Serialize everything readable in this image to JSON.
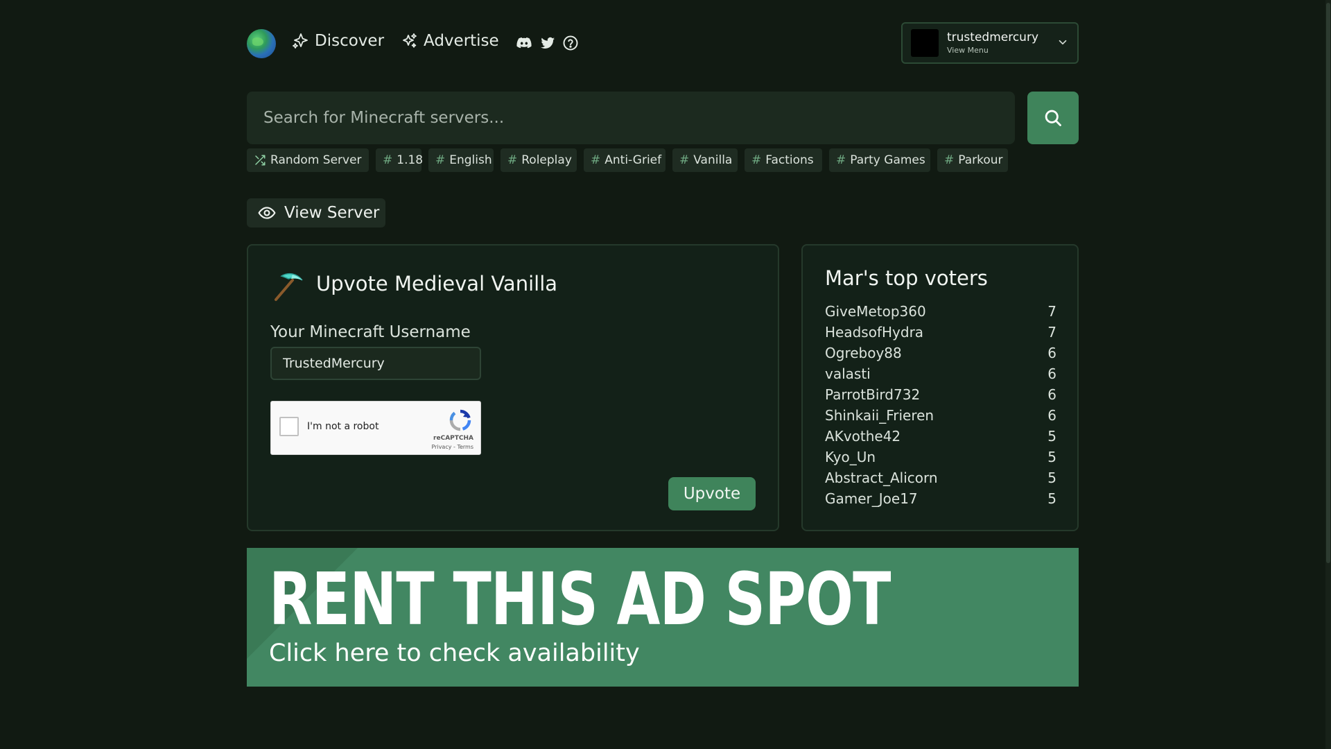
{
  "nav": {
    "discover": "Discover",
    "advertise": "Advertise",
    "icons": [
      "sparkle-icon",
      "sparkles-icon",
      "discord-icon",
      "twitter-icon",
      "help-circle-icon"
    ]
  },
  "user": {
    "name": "trustedmercury",
    "sub": "View Menu"
  },
  "search": {
    "placeholder": "Search for Minecraft servers..."
  },
  "tags": {
    "random": "Random Server",
    "items": [
      "1.18",
      "English",
      "Roleplay",
      "Anti-Grief",
      "Vanilla",
      "Factions",
      "Party Games",
      "Parkour"
    ],
    "hash": "#"
  },
  "view_server": "View Server",
  "vote": {
    "title": "Upvote Medieval Vanilla",
    "field_label": "Your Minecraft Username",
    "username": "TrustedMercury",
    "captcha_text": "I'm not a robot",
    "captcha_brand": "reCAPTCHA",
    "captcha_links": "Privacy - Terms",
    "button": "Upvote"
  },
  "top_voters": {
    "title": "Mar's top voters",
    "list": [
      {
        "name": "GiveMetop360",
        "votes": "7"
      },
      {
        "name": "HeadsofHydra",
        "votes": "7"
      },
      {
        "name": "Ogreboy88",
        "votes": "6"
      },
      {
        "name": "valasti",
        "votes": "6"
      },
      {
        "name": "ParrotBird732",
        "votes": "6"
      },
      {
        "name": "Shinkaii_Frieren",
        "votes": "6"
      },
      {
        "name": "AKvothe42",
        "votes": "5"
      },
      {
        "name": "Kyo_Un",
        "votes": "5"
      },
      {
        "name": "Abstract_Alicorn",
        "votes": "5"
      },
      {
        "name": "Gamer_Joe17",
        "votes": "5"
      }
    ]
  },
  "ad": {
    "headline": "RENT THIS AD SPOT",
    "sub": "Click here to check availability"
  },
  "colors": {
    "background": "#111a12",
    "accent": "#3f845b",
    "card": "#132118"
  }
}
